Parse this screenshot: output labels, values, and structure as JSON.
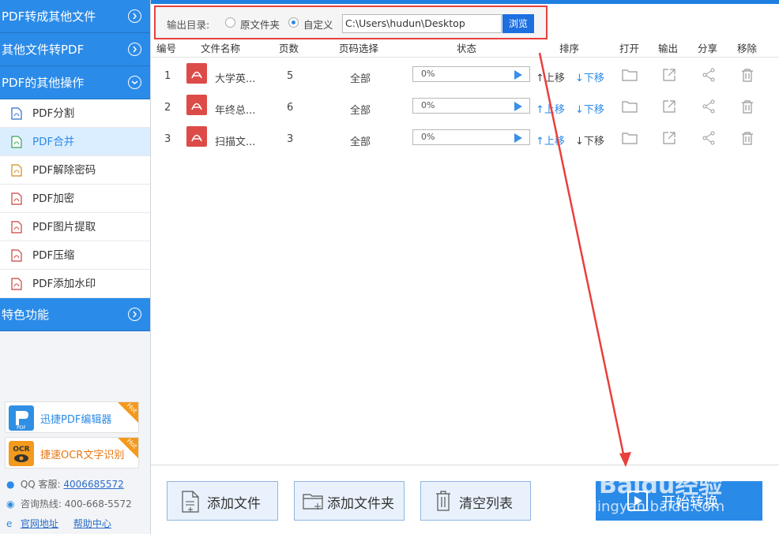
{
  "sidebar": {
    "categories": [
      {
        "label": "PDF转成其他文件"
      },
      {
        "label": "其他文件转PDF"
      },
      {
        "label": "PDF的其他操作"
      },
      {
        "label": "特色功能"
      }
    ],
    "items": [
      {
        "label": "PDF分割"
      },
      {
        "label": "PDF合并"
      },
      {
        "label": "PDF解除密码"
      },
      {
        "label": "PDF加密"
      },
      {
        "label": "PDF图片提取"
      },
      {
        "label": "PDF压缩"
      },
      {
        "label": "PDF添加水印"
      }
    ],
    "promos": [
      {
        "label": "迅捷PDF编辑器",
        "badge": "Hot",
        "logo_text": "PDF"
      },
      {
        "label": "捷速OCR文字识别",
        "badge": "Hot",
        "logo_text": "OCR"
      }
    ],
    "contact": {
      "qq_label": "QQ 客服:",
      "qq_value": "4006685572",
      "hotline_label": "咨询热线:",
      "hotline_value": "400-668-5572",
      "website": "官网地址",
      "help": "帮助中心"
    }
  },
  "output": {
    "label": "输出目录:",
    "option_source": "原文件夹",
    "option_custom": "自定义",
    "path": "C:\\Users\\hudun\\Desktop",
    "browse": "浏览"
  },
  "table": {
    "headers": {
      "no": "编号",
      "name": "文件名称",
      "pages": "页数",
      "range": "页码选择",
      "status": "状态",
      "order": "排序",
      "open": "打开",
      "export": "输出",
      "share": "分享",
      "remove": "移除"
    },
    "rows": [
      {
        "no": "1",
        "name": "大学英...",
        "pages": "5",
        "range": "全部",
        "progress": "0%",
        "up": "↑上移",
        "down": "↓下移"
      },
      {
        "no": "2",
        "name": "年终总...",
        "pages": "6",
        "range": "全部",
        "progress": "0%",
        "up": "↑上移",
        "down": "↓下移"
      },
      {
        "no": "3",
        "name": "扫描文...",
        "pages": "3",
        "range": "全部",
        "progress": "0%",
        "up": "↑上移",
        "down": "↓下移"
      }
    ]
  },
  "buttons": {
    "add_file": "添加文件",
    "add_folder": "添加文件夹",
    "clear": "清空列表",
    "start": "开始转换"
  },
  "watermark": {
    "line1": "Baidu经验",
    "line2": "jingyan.baidu.com"
  },
  "colors": {
    "accent": "#2b8be8",
    "highlight": "#e8403c",
    "pdf_red": "#dd4b48"
  }
}
